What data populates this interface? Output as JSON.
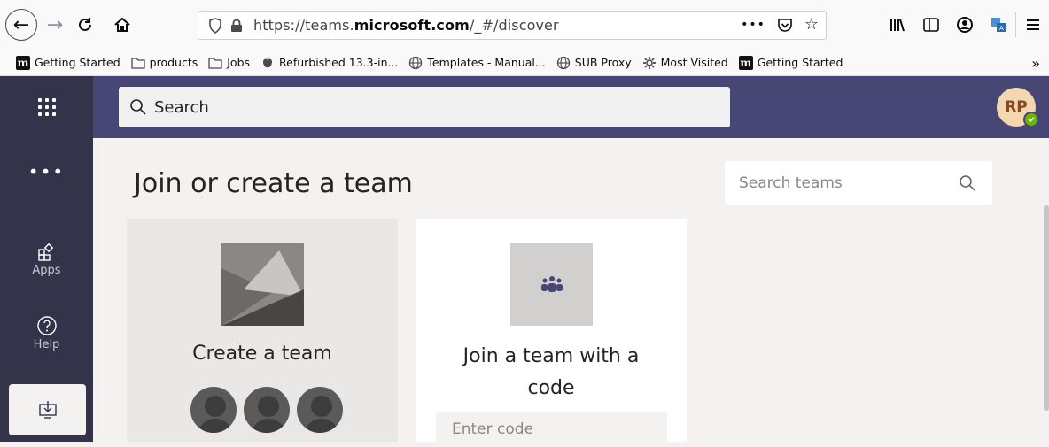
{
  "browser": {
    "url_prefix": "https://teams.",
    "url_domain": "microsoft.com",
    "url_path": "/_#/discover",
    "more_actions": "•••"
  },
  "bookmarks": [
    {
      "label": "Getting Started",
      "icon": "m-logo"
    },
    {
      "label": "products",
      "icon": "folder-icon"
    },
    {
      "label": "Jobs",
      "icon": "folder-icon"
    },
    {
      "label": "Refurbished 13.3-in...",
      "icon": "apple-icon"
    },
    {
      "label": "Templates - Manual...",
      "icon": "globe-icon"
    },
    {
      "label": "SUB Proxy",
      "icon": "globe-icon"
    },
    {
      "label": "Most Visited",
      "icon": "gear-icon"
    },
    {
      "label": "Getting Started",
      "icon": "m-logo"
    }
  ],
  "bookmark_logo_letter": "m",
  "teams": {
    "search_label": "Search",
    "avatar_initials": "RP",
    "rail": {
      "more": "•••",
      "apps": "Apps",
      "help": "Help"
    },
    "page_title": "Join or create a team",
    "search_teams_placeholder": "Search teams",
    "create_card_title": "Create a team",
    "join_card_title": "Join a team with a code",
    "join_code_placeholder": "Enter code"
  },
  "colors": {
    "header": "#464775",
    "rail": "#33344a",
    "background": "#f3f2f1"
  }
}
